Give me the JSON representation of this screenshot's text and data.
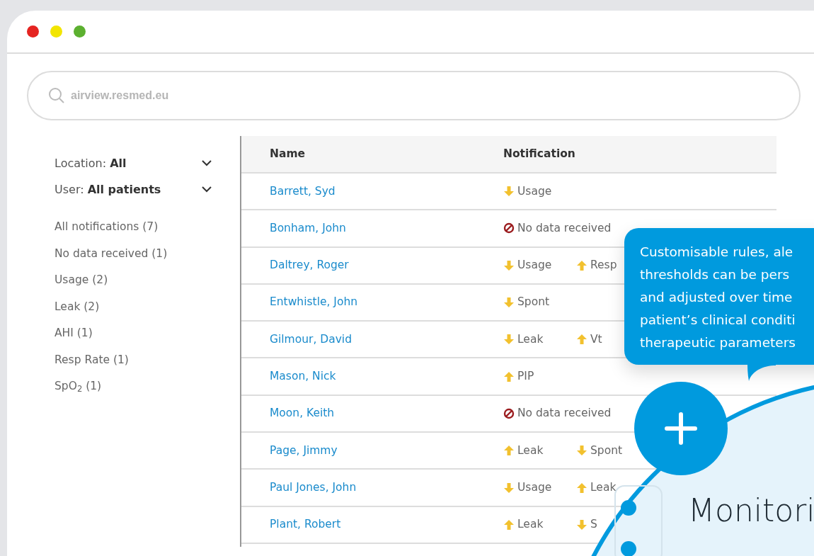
{
  "address_bar": {
    "text": "airview.resmed.eu"
  },
  "filters": [
    {
      "label": "Location:",
      "value": "All"
    },
    {
      "label": "User:",
      "value": "All patients"
    }
  ],
  "categories": [
    "All notifications (7)",
    "No data received (1)",
    "Usage (2)",
    "Leak (2)",
    "AHI (1)",
    "Resp Rate (1)",
    "SpO$_{2}$ (1)"
  ],
  "table": {
    "columns": [
      "Name",
      "Notification"
    ],
    "rows": [
      {
        "name": "Barrett, Syd",
        "notifications": [
          {
            "kind": "down",
            "label": "Usage"
          }
        ]
      },
      {
        "name": "Bonham, John",
        "notifications": [
          {
            "kind": "none",
            "label": "No data received"
          }
        ]
      },
      {
        "name": "Daltrey, Roger",
        "notifications": [
          {
            "kind": "down",
            "label": "Usage"
          },
          {
            "kind": "up",
            "label": "Resp"
          }
        ]
      },
      {
        "name": "Entwhistle, John",
        "notifications": [
          {
            "kind": "down",
            "label": "Spont"
          }
        ]
      },
      {
        "name": "Gilmour, David",
        "notifications": [
          {
            "kind": "down",
            "label": "Leak"
          },
          {
            "kind": "up",
            "label": "Vt"
          }
        ]
      },
      {
        "name": "Mason, Nick",
        "notifications": [
          {
            "kind": "up",
            "label": "PIP"
          }
        ]
      },
      {
        "name": "Moon, Keith",
        "notifications": [
          {
            "kind": "none",
            "label": "No data received"
          }
        ]
      },
      {
        "name": "Page, Jimmy",
        "notifications": [
          {
            "kind": "up",
            "label": "Leak"
          },
          {
            "kind": "down",
            "label": "Spont"
          }
        ]
      },
      {
        "name": "Paul Jones, John",
        "notifications": [
          {
            "kind": "down",
            "label": "Usage"
          },
          {
            "kind": "up",
            "label": "Leak"
          }
        ]
      },
      {
        "name": "Plant, Robert",
        "notifications": [
          {
            "kind": "up",
            "label": "Leak"
          },
          {
            "kind": "down",
            "label": "S"
          }
        ]
      }
    ]
  },
  "callout": {
    "text": "Customisable rules, ale\nthresholds can be pers\nand adjusted over time\npatient’s clinical conditi\ntherapeutic parameters"
  },
  "feature": {
    "title": "Monitori"
  }
}
